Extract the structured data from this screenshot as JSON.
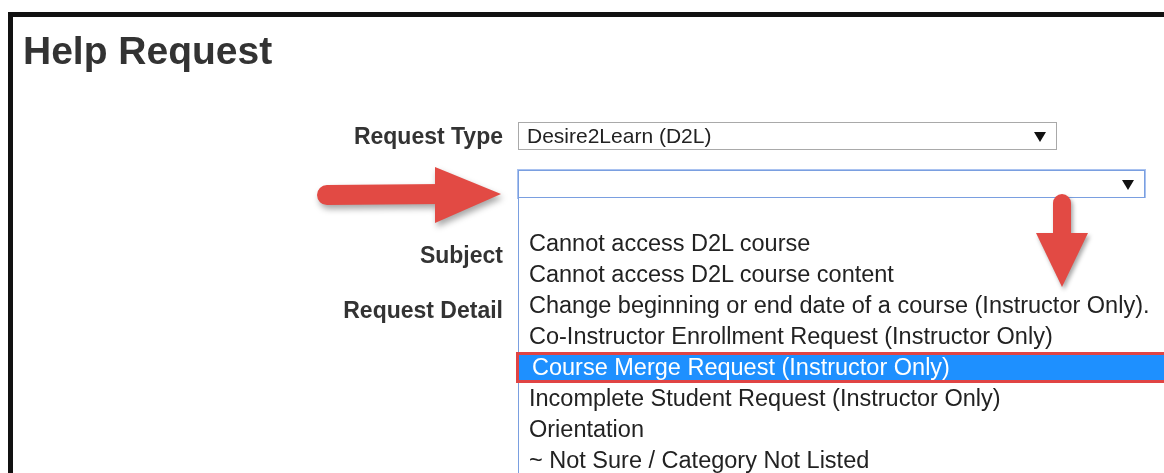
{
  "title": "Help Request",
  "form": {
    "rows": [
      {
        "label": "Request Type",
        "kind": "select",
        "value": "Desire2Learn (D2L)",
        "focused": false
      },
      {
        "kind": "select",
        "focused": true
      },
      {
        "label": "Subject",
        "kind": "label"
      },
      {
        "label": "Request Detail",
        "kind": "label"
      }
    ]
  },
  "dropdown": {
    "options": [
      {
        "label": "Cannot access D2L course",
        "selected": false
      },
      {
        "label": "Cannot access D2L course content",
        "selected": false
      },
      {
        "label": "Change beginning or end date of a course (Instructor Only).",
        "selected": false
      },
      {
        "label": "Co-Instructor Enrollment Request (Instructor Only)",
        "selected": false
      },
      {
        "label": "Course Merge Request (Instructor Only)",
        "selected": true
      },
      {
        "label": "Incomplete Student Request (Instructor Only)",
        "selected": false
      },
      {
        "label": "Orientation",
        "selected": false
      },
      {
        "label": "~ Not Sure / Category Not Listed",
        "selected": false
      }
    ]
  }
}
